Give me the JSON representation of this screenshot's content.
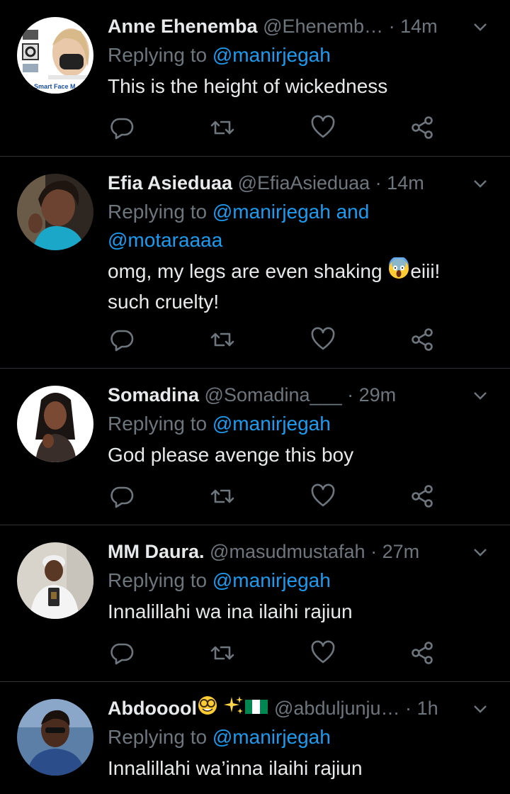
{
  "colors": {
    "background": "#000000",
    "name": "#e7e9ea",
    "muted": "#6e767d",
    "link": "#1d9bf0",
    "divider": "#2f3336"
  },
  "tweets": [
    {
      "name": "Anne Ehenemba",
      "handle": "@Ehenemb…",
      "time": "14m",
      "replying_prefix": "Replying to",
      "mentions": "@manirjegah",
      "text_lines": [
        "This is the height of wickedness"
      ],
      "avatar_caption": "Smart Face M"
    },
    {
      "name": "Efia Asieduaa",
      "handle": "@EfiaAsieduaa",
      "time": "14m",
      "replying_prefix": "Replying to",
      "mentions": "@manirjegah and",
      "mentions_2": "@motaraaaa",
      "text_lines": [
        "omg, my legs are even shaking ",
        "eiii!",
        "such cruelty!"
      ]
    },
    {
      "name": "Somadina",
      "handle": "@Somadina___",
      "time": "29m",
      "replying_prefix": "Replying to",
      "mentions": "@manirjegah",
      "text_lines": [
        "God please avenge this boy"
      ]
    },
    {
      "name": "MM Daura.",
      "handle": "@masudmustafah",
      "time": "27m",
      "replying_prefix": "Replying to",
      "mentions": "@manirjegah",
      "text_lines": [
        "Innalillahi wa ina ilaihi rajiun"
      ]
    },
    {
      "name": "Abdooool",
      "handle": "@abduljunju…",
      "time": "1h",
      "replying_prefix": "Replying to",
      "mentions": "@manirjegah",
      "text_lines": [
        "Innalillahi wa’inna ilaihi rajiun"
      ]
    }
  ],
  "separator": "·",
  "icons": [
    "reply-icon",
    "retweet-icon",
    "like-icon",
    "share-icon",
    "chevron-down-icon",
    "screaming-emoji",
    "nerd-emoji",
    "sparkles-emoji",
    "nigeria-flag-emoji"
  ]
}
